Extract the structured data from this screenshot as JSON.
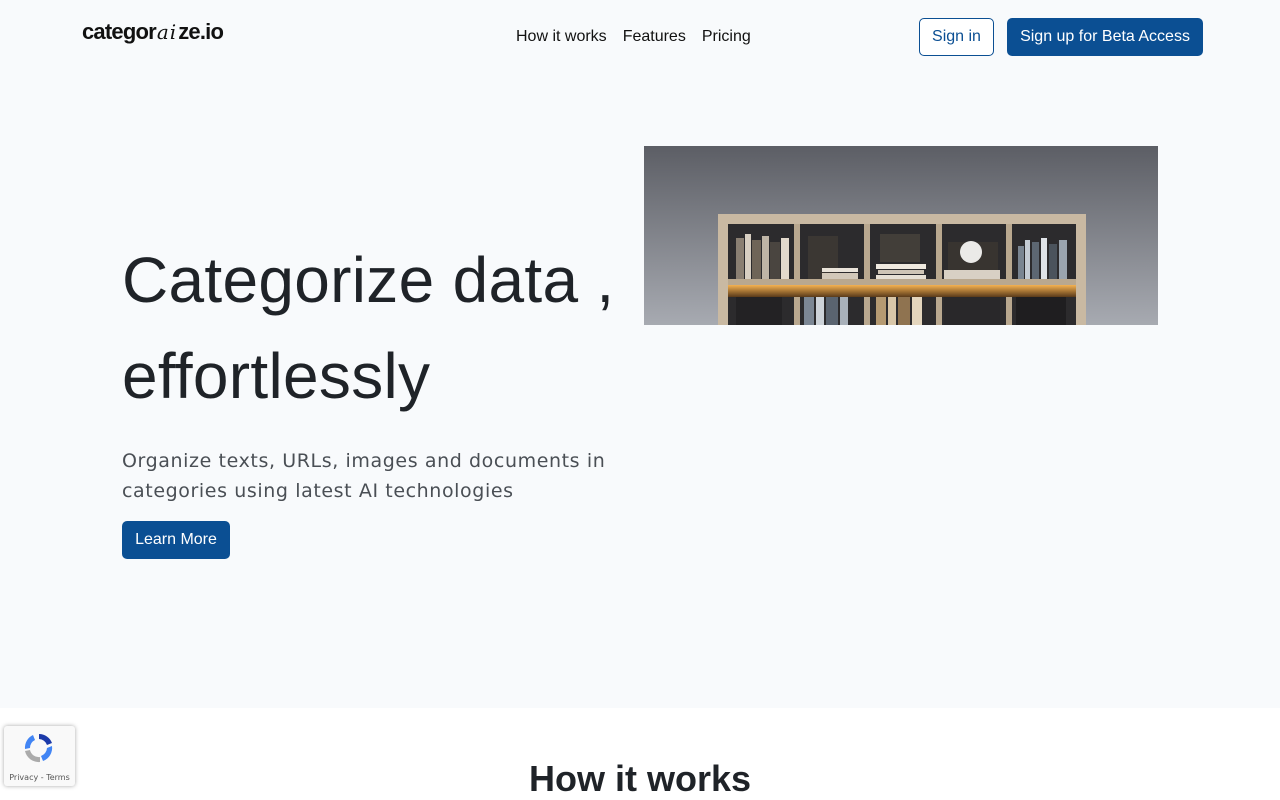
{
  "header": {
    "logo_prefix": "categor",
    "logo_ai": "ai",
    "logo_suffix": "ze.io",
    "nav": [
      "How it works",
      "Features",
      "Pricing"
    ],
    "signin_label": "Sign in",
    "signup_label": "Sign up for Beta Access"
  },
  "hero": {
    "title_line1": "Categorize data ,",
    "title_line2": "effortlessly",
    "subtitle": "Organize texts, URLs, images and documents in categories using latest AI technologies",
    "cta_label": "Learn More",
    "image_icon": "bookshelf-image"
  },
  "section2": {
    "title": "How it works"
  },
  "recaptcha": {
    "privacy": "Privacy",
    "separator": "-",
    "terms": "Terms",
    "icon": "recaptcha-icon"
  },
  "colors": {
    "accent": "#0b4f93",
    "background": "#f8fafc",
    "text": "#1f2328"
  }
}
